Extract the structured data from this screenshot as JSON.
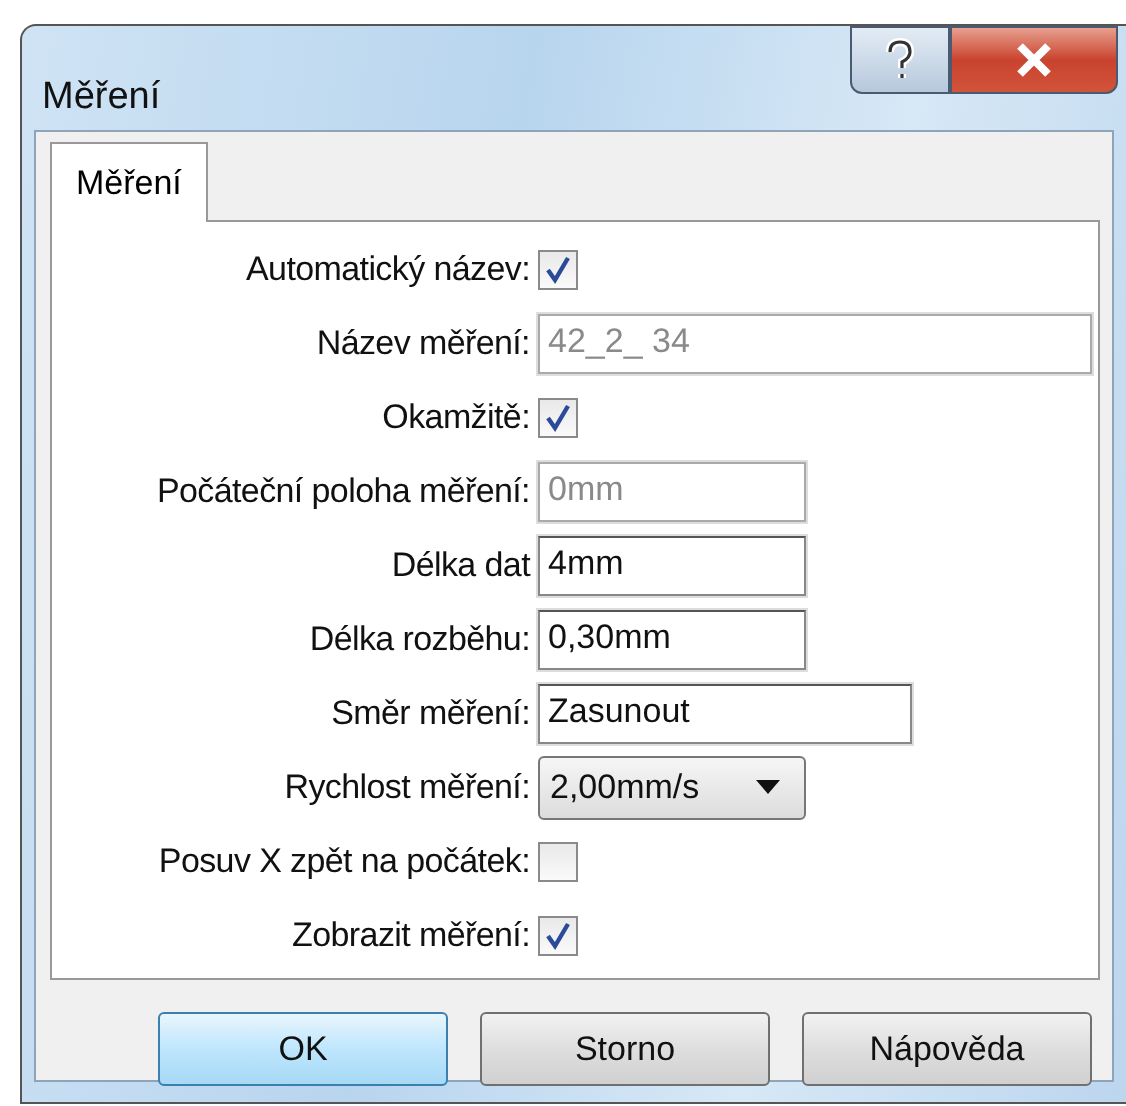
{
  "window": {
    "title": "Měření"
  },
  "tabs": [
    {
      "label": "Měření",
      "selected": true
    }
  ],
  "rows": [
    {
      "kind": "checkbox",
      "label": "Automatický název:",
      "checked": true
    },
    {
      "kind": "field",
      "label": "Název měření:",
      "value": "42_2_ 34",
      "disabled": true
    },
    {
      "kind": "checkbox",
      "label": "Okamžitě:",
      "checked": true
    },
    {
      "kind": "field",
      "label": "Počáteční poloha měření:",
      "value": "0mm",
      "disabled": true
    },
    {
      "kind": "field",
      "label": "Délka dat",
      "value": "4mm",
      "disabled": false
    },
    {
      "kind": "field",
      "label": "Délka rozběhu:",
      "value": "0,30mm",
      "disabled": false
    },
    {
      "kind": "field",
      "label": "Směr měření:",
      "value": "Zasunout",
      "disabled": false
    },
    {
      "kind": "dropdown",
      "label": "Rychlost měření:",
      "value": "2,00mm/s"
    },
    {
      "kind": "checkbox",
      "label": "Posuv X zpět na počátek:",
      "checked": false
    },
    {
      "kind": "checkbox",
      "label": "Zobrazit měření:",
      "checked": true
    }
  ],
  "buttons": [
    {
      "label": "OK",
      "default": true
    },
    {
      "label": "Storno",
      "default": false
    },
    {
      "label": "Nápověda",
      "default": false
    }
  ]
}
